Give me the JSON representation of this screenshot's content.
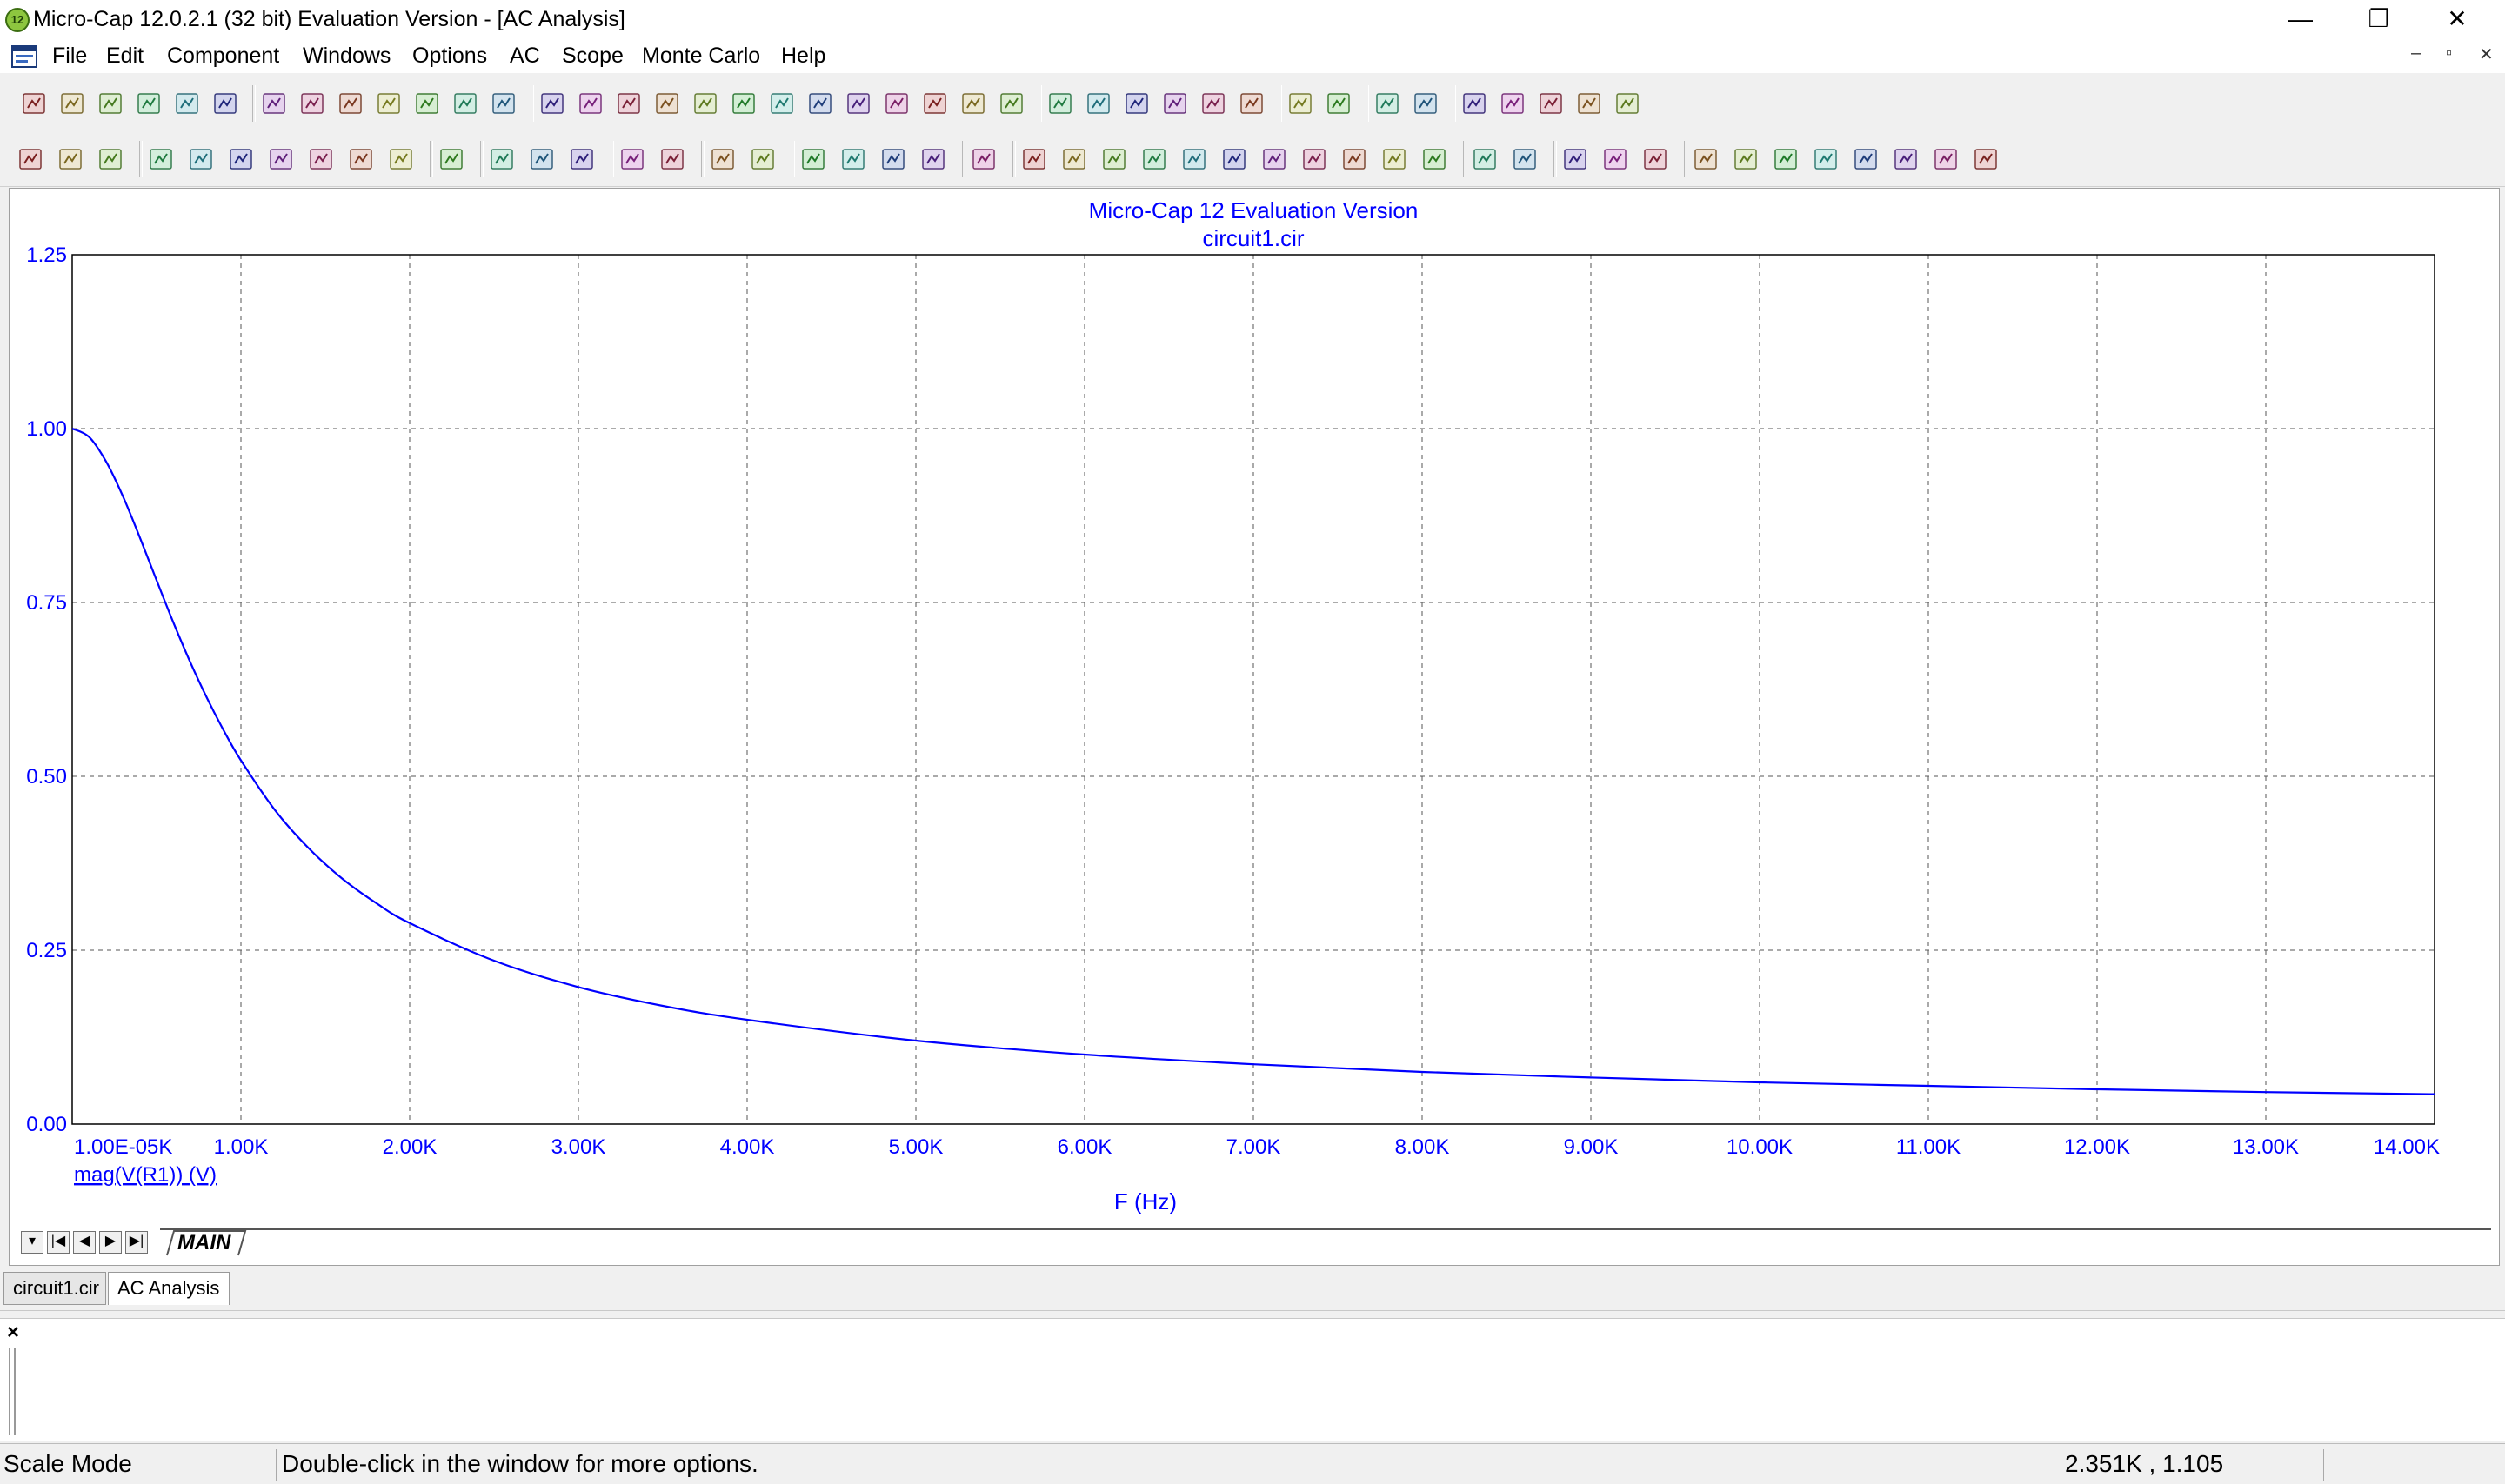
{
  "window": {
    "app_badge": "12",
    "title": "Micro-Cap 12.0.2.1 (32 bit) Evaluation Version - [AC Analysis]",
    "minimize_glyph": "—",
    "restore_glyph": "❐",
    "close_glyph": "✕"
  },
  "menu": {
    "items": [
      "File",
      "Edit",
      "Component",
      "Windows",
      "Options",
      "AC",
      "Scope",
      "Monte Carlo",
      "Help"
    ],
    "mdi_minimize": "–",
    "mdi_restore": "▫",
    "mdi_close": "✕"
  },
  "toolbar_icons": {
    "row1": [
      "new-icon",
      "open-icon",
      "save-icon",
      "revert-icon",
      "print-preview-icon",
      "print-icon",
      "undo-icon",
      "redo-icon",
      "cut-icon",
      "copy-icon",
      "paste-icon",
      "delete-icon",
      "select-all-icon",
      "ground-icon",
      "resistor-icon",
      "capacitor-icon",
      "inductor-icon",
      "diode-icon",
      "transistor-icon",
      "mosfet-icon",
      "opamp-icon",
      "macro-icon",
      "battery-icon",
      "source-icon",
      "voltage-source-icon",
      "cascade-icon",
      "tile-vertical-icon",
      "tile-horizontal-icon",
      "arrange-icon",
      "window-icon",
      "calculator-icon",
      "component-panel-icon",
      "component-editor-icon",
      "globe-icon",
      "shape-library-icon",
      "model-icon",
      "package-editor-icon",
      "check-icon",
      "tools-icon",
      "plot-icon",
      "animate-icon"
    ],
    "row2": [
      "select-arrow-icon",
      "pan-hand-icon",
      "scale-icon",
      "zoom-region-icon",
      "auto-scale-icon",
      "restore-limits-icon",
      "redraw-icon",
      "add-curve-icon",
      "formula-icon",
      "text-icon",
      "properties-icon",
      "run-icon",
      "stop-icon",
      "pause-icon",
      "graph-tool-icon",
      "tag-icon",
      "grid-icon",
      "minor-grid-icon",
      "same-y-scales-icon",
      "stack-icon",
      "shift-icon",
      "tokens-icon",
      "separate-icon",
      "cursor-mode-icon",
      "peak-icon",
      "valley-icon",
      "high-icon",
      "low-icon",
      "inflection-icon",
      "global-high-icon",
      "global-low-icon",
      "slope-icon",
      "top-icon",
      "bottom-icon",
      "preferences-icon",
      "notes-icon",
      "numeric-output-icon",
      "overlay-icon",
      "horizontal-tag-icon",
      "zoom-in-icon",
      "zoom-out-icon",
      "zoom-fit-icon",
      "tile-icon",
      "font-icon",
      "color-icon",
      "bring-front-icon",
      "send-back-icon"
    ]
  },
  "chart_data": {
    "type": "line",
    "title": "Micro-Cap 12 Evaluation Version",
    "subtitle": "circuit1.cir",
    "xlabel": "F (Hz)",
    "ylabel": "",
    "xlim": [
      0,
      14000
    ],
    "ylim": [
      0,
      1.25
    ],
    "grid": true,
    "x_tick_values": [
      0,
      1000,
      2000,
      3000,
      4000,
      5000,
      6000,
      7000,
      8000,
      9000,
      10000,
      11000,
      12000,
      13000,
      14000
    ],
    "x_tick_labels": [
      "1.00E-05K",
      "1.00K",
      "2.00K",
      "3.00K",
      "4.00K",
      "5.00K",
      "6.00K",
      "7.00K",
      "8.00K",
      "9.00K",
      "10.00K",
      "11.00K",
      "12.00K",
      "13.00K",
      "14.00K"
    ],
    "y_tick_values": [
      0,
      0.25,
      0.5,
      0.75,
      1.0,
      1.25
    ],
    "y_tick_labels": [
      "0.00",
      "0.25",
      "0.50",
      "0.75",
      "1.00",
      "1.25"
    ],
    "series": [
      {
        "name": "mag(V(R1)) (V)",
        "color": "#0000ff",
        "x": [
          0,
          100,
          200,
          300,
          400,
          500,
          600,
          700,
          800,
          900,
          1000,
          1200,
          1400,
          1600,
          1800,
          2000,
          2500,
          3000,
          3500,
          4000,
          5000,
          6000,
          7000,
          8000,
          9000,
          10000,
          11000,
          12000,
          13000,
          14000
        ],
        "y": [
          1.0,
          0.988,
          0.953,
          0.903,
          0.844,
          0.782,
          0.721,
          0.664,
          0.612,
          0.565,
          0.523,
          0.452,
          0.397,
          0.353,
          0.318,
          0.289,
          0.235,
          0.197,
          0.17,
          0.15,
          0.12,
          0.1,
          0.086,
          0.075,
          0.067,
          0.06,
          0.055,
          0.05,
          0.046,
          0.043
        ]
      }
    ],
    "legend": "bottom-left"
  },
  "sheet": {
    "nav_first": "|◀",
    "nav_prev": "◀",
    "nav_next": "▶",
    "nav_last": "▶|",
    "nav_menu": "▾",
    "tab_label": "MAIN"
  },
  "doc_tabs": [
    "circuit1.cir",
    "AC Analysis"
  ],
  "output_pane": {
    "close_glyph": "×"
  },
  "status": {
    "mode": "Scale Mode",
    "hint": "Double-click in the window for more options.",
    "coords": "2.351K , 1.105"
  }
}
